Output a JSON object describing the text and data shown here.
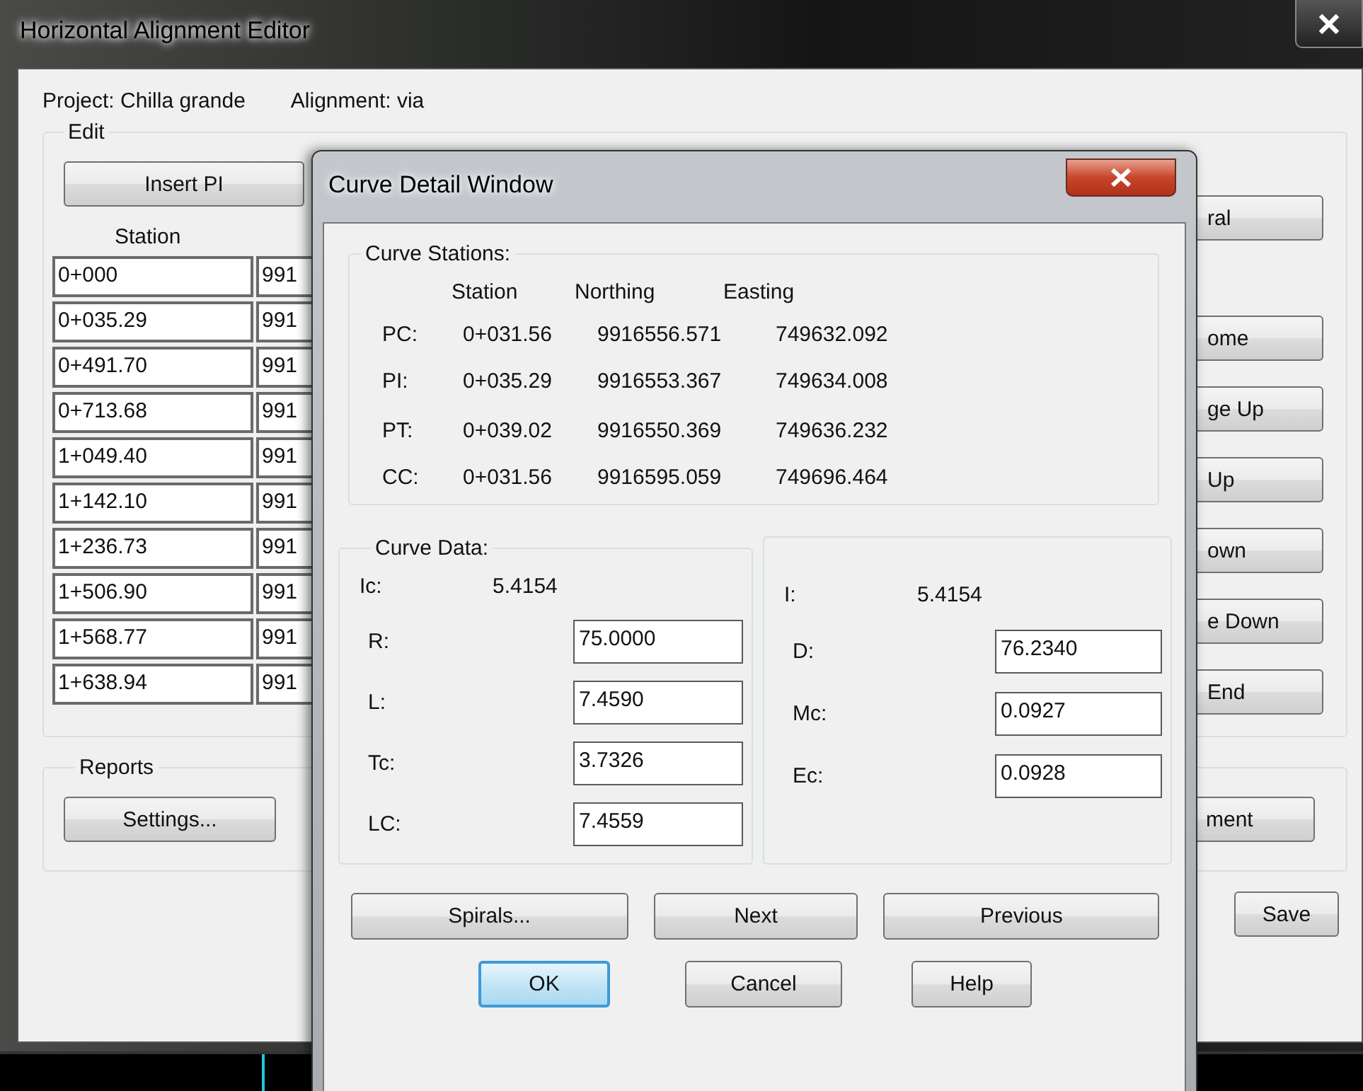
{
  "main_window": {
    "title": "Horizontal Alignment Editor",
    "project_label": "Project: Chilla grande",
    "alignment_label": "Alignment: via",
    "edit_group": {
      "title": "Edit",
      "insert_button": "Insert PI",
      "station_header": "Station",
      "rows": [
        {
          "station": "0+000",
          "column_2": "991"
        },
        {
          "station": "0+035.29",
          "column_2": "991"
        },
        {
          "station": "0+491.70",
          "column_2": "991"
        },
        {
          "station": "0+713.68",
          "column_2": "991"
        },
        {
          "station": "1+049.40",
          "column_2": "991"
        },
        {
          "station": "1+142.10",
          "column_2": "991"
        },
        {
          "station": "1+236.73",
          "column_2": "991"
        },
        {
          "station": "1+506.90",
          "column_2": "991"
        },
        {
          "station": "1+568.77",
          "column_2": "991"
        },
        {
          "station": "1+638.94",
          "column_2": "991"
        }
      ],
      "side_buttons": [
        "ral",
        "ome",
        "ge Up",
        "Up",
        "own",
        "e Down",
        "End"
      ]
    },
    "reports_group": {
      "title": "Reports",
      "settings_button": "Settings...",
      "right_button": "ment"
    },
    "save_button": "Save"
  },
  "dialog": {
    "title": "Curve Detail Window",
    "stations_group": {
      "title": "Curve Stations:",
      "columns": [
        "Station",
        "Northing",
        "Easting"
      ],
      "rows": [
        {
          "label": "PC:",
          "station": "0+031.56",
          "northing": "9916556.571",
          "easting": "749632.092"
        },
        {
          "label": "PI:",
          "station": "0+035.29",
          "northing": "9916553.367",
          "easting": "749634.008"
        },
        {
          "label": "PT:",
          "station": "0+039.02",
          "northing": "9916550.369",
          "easting": "749636.232"
        },
        {
          "label": "CC:",
          "station": "0+031.56",
          "northing": "9916595.059",
          "easting": "749696.464"
        }
      ]
    },
    "curve_data": {
      "title": "Curve Data:",
      "left": [
        {
          "kind": "readout",
          "label": "Ic:",
          "value": "5.4154"
        },
        {
          "kind": "field",
          "label": "R:",
          "value": "75.0000"
        },
        {
          "kind": "field",
          "label": "L:",
          "value": "7.4590"
        },
        {
          "kind": "field",
          "label": "Tc:",
          "value": "3.7326"
        },
        {
          "kind": "field",
          "label": "LC:",
          "value": "7.4559"
        }
      ],
      "right": [
        {
          "kind": "readout",
          "label": "I:",
          "value": "5.4154"
        },
        {
          "kind": "field",
          "label": "D:",
          "value": "76.2340"
        },
        {
          "kind": "field",
          "label": "Mc:",
          "value": "0.0927"
        },
        {
          "kind": "field",
          "label": "Ec:",
          "value": "0.0928"
        }
      ]
    },
    "action_buttons": [
      "Spirals...",
      "Next",
      "Previous"
    ],
    "dialog_buttons": [
      {
        "label": "OK",
        "default": true
      },
      {
        "label": "Cancel",
        "default": false
      },
      {
        "label": "Help",
        "default": false
      }
    ]
  }
}
